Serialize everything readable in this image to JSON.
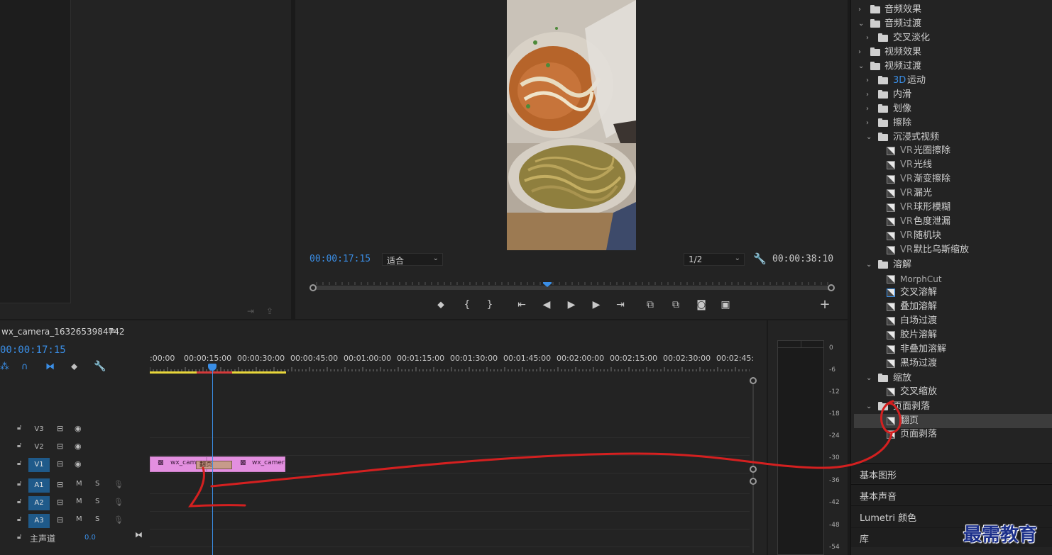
{
  "program_monitor": {
    "current_timecode": "00:00:17:15",
    "duration_timecode": "00:00:38:10",
    "fit_select": "适合",
    "resolution_select": "1/2"
  },
  "timeline": {
    "sequence_name": "wx_camera_1632653984742",
    "menu_glyph": "≡",
    "current_timecode": "00:00:17:15",
    "ruler_labels": [
      ":00:00",
      "00:00:15:00",
      "00:00:30:00",
      "00:00:45:00",
      "00:01:00:00",
      "00:01:15:00",
      "00:01:30:00",
      "00:01:45:00",
      "00:02:00:00",
      "00:02:15:00",
      "00:02:30:00",
      "00:02:45:"
    ],
    "tracks": {
      "v3": "V3",
      "v2": "V2",
      "v1": "V1",
      "a1": "A1",
      "a2": "A2",
      "a3": "A3",
      "mute": "M",
      "solo": "S"
    },
    "master": {
      "label": "主声道",
      "value": "0.0"
    },
    "clips": {
      "clip1": "wx_cam",
      "clip2": "wx_camer",
      "transition": "翻页"
    }
  },
  "meter": {
    "labels": [
      "0",
      "-6",
      "-12",
      "-18",
      "-24",
      "-30",
      "-36",
      "-42",
      "-48",
      "-54"
    ]
  },
  "effects": {
    "audio_effects": "音频效果",
    "audio_transitions": "音频过渡",
    "crossfade": "交叉淡化",
    "video_effects": "视频效果",
    "video_transitions": "视频过渡",
    "motion_3d_prefix": "3D",
    "motion_3d": "运动",
    "slide": "内滑",
    "iris": "划像",
    "wipe": "擦除",
    "immersive": "沉浸式视频",
    "vr_prefix": "VR",
    "vr_items": [
      "光圈擦除",
      "光线",
      "渐变擦除",
      "漏光",
      "球形模糊",
      "色度泄漏",
      "随机块",
      "默比乌斯缩放"
    ],
    "dissolve": "溶解",
    "dissolve_items": [
      "MorphCut",
      "交叉溶解",
      "叠加溶解",
      "白场过渡",
      "胶片溶解",
      "非叠加溶解",
      "黑场过渡"
    ],
    "zoom": "缩放",
    "cross_zoom": "交叉缩放",
    "page_peel": "页面剥落",
    "page_turn": "翻页",
    "page_peel_item": "页面剥落"
  },
  "panels": {
    "essential_graphics": "基本图形",
    "essential_sound": "基本声音",
    "lumetri": "Lumetri 颜色",
    "libraries": "库"
  },
  "watermark": "最需教育",
  "colors": {
    "accent_blue": "#3a8ee6",
    "clip_pink": "#e38fe0",
    "annotation_red": "#d42020",
    "panel_bg": "#232323"
  }
}
